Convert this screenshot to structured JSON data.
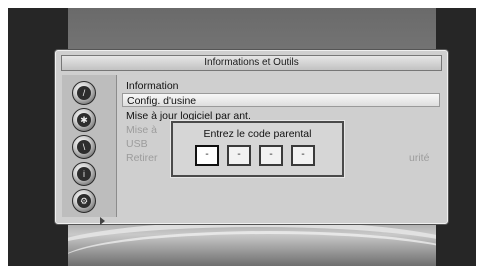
{
  "window": {
    "title": "Informations et Outils"
  },
  "sidebar": {
    "icons": [
      {
        "name": "slash-icon",
        "glyph": "/"
      },
      {
        "name": "gear-icon",
        "glyph": "✱"
      },
      {
        "name": "tools-icon",
        "glyph": "\\"
      },
      {
        "name": "info-icon",
        "glyph": "i"
      },
      {
        "name": "settings-icon",
        "glyph": "⚙"
      }
    ],
    "active_index": 3
  },
  "menu": {
    "items": [
      {
        "label": "Information",
        "state": "normal"
      },
      {
        "label": "Config. d'usine",
        "state": "selected"
      },
      {
        "label": "Mise à jour logiciel par ant.",
        "state": "normal"
      },
      {
        "label": "Mise à",
        "state": "dim"
      },
      {
        "label": "USB",
        "state": "dim"
      },
      {
        "label": "Retirer",
        "state": "dim"
      },
      {
        "label": "urité",
        "state": "dim"
      }
    ]
  },
  "dialog": {
    "title": "Entrez le code parental",
    "pins": [
      "-",
      "-",
      "-",
      "-"
    ]
  }
}
